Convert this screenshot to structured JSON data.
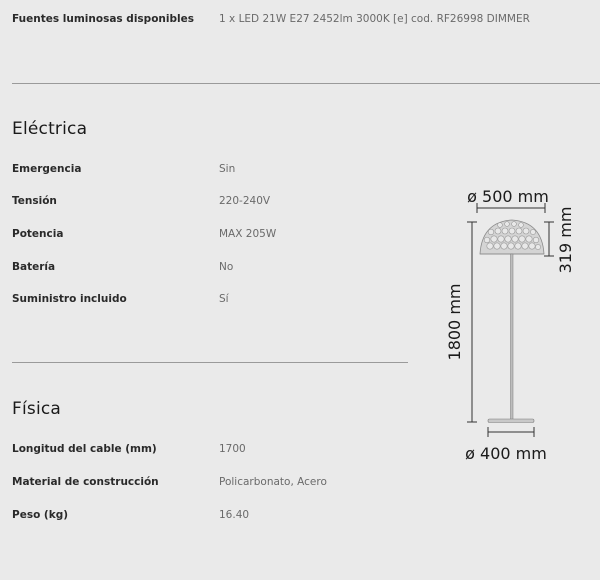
{
  "top": {
    "label": "Fuentes luminosas disponibles",
    "value": "1 x LED 21W E27 2452lm 3000K [e] cod. RF26998 DIMMER"
  },
  "electrica": {
    "title": "Eléctrica",
    "rows": [
      {
        "label": "Emergencia",
        "value": "Sin"
      },
      {
        "label": "Tensión",
        "value": "220-240V"
      },
      {
        "label": "Potencia",
        "value": "MAX 205W"
      },
      {
        "label": "Batería",
        "value": "No"
      },
      {
        "label": "Suministro incluido",
        "value": "Sí"
      }
    ]
  },
  "fisica": {
    "title": "Física",
    "rows": [
      {
        "label": "Longitud del cable (mm)",
        "value": "1700"
      },
      {
        "label": "Material de construcción",
        "value": "Policarbonato, Acero"
      },
      {
        "label": "Peso (kg)",
        "value": "16.40"
      }
    ]
  },
  "drawing": {
    "shade_diameter": "ø 500 mm",
    "shade_height": "319 mm",
    "total_height": "1800 mm",
    "base_diameter": "ø 400 mm"
  }
}
